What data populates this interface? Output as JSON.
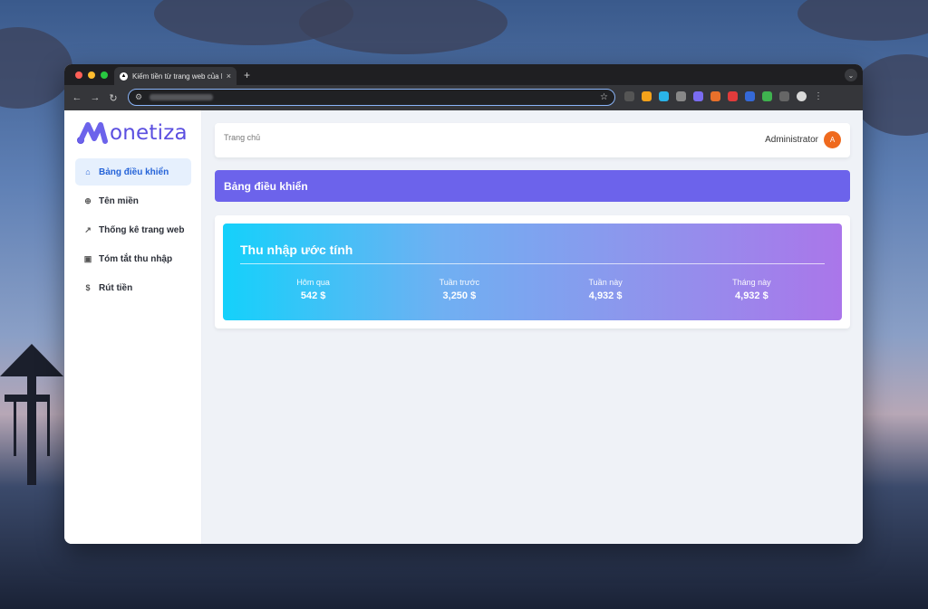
{
  "browser": {
    "tab_title": "Kiếm tiền từ trang web của bạ",
    "tab_close": "×",
    "new_tab": "+",
    "favicon_glyph": "▲"
  },
  "app": {
    "logo_text": "onetiza",
    "sidebar": {
      "items": [
        {
          "label": "Bảng điều khiển",
          "icon": "home-icon",
          "glyph": "⌂",
          "active": true
        },
        {
          "label": "Tên miền",
          "icon": "globe-icon",
          "glyph": "⊕"
        },
        {
          "label": "Thống kê trang web",
          "icon": "trending-up-icon",
          "glyph": "↗"
        },
        {
          "label": "Tóm tắt thu nhập",
          "icon": "wallet-icon",
          "glyph": "▣"
        },
        {
          "label": "Rút tiền",
          "icon": "dollar-circle-icon",
          "glyph": "$"
        }
      ]
    },
    "header": {
      "breadcrumb": "Trang chủ",
      "user_name": "Administrator",
      "avatar_initial": "A"
    },
    "page_title": "Bảng điều khiển",
    "earnings": {
      "title": "Thu nhập ước tính",
      "stats": [
        {
          "label": "Hôm qua",
          "value": "542 $"
        },
        {
          "label": "Tuần trước",
          "value": "3,250 $"
        },
        {
          "label": "Tuần này",
          "value": "4,932 $"
        },
        {
          "label": "Tháng này",
          "value": "4,932 $"
        }
      ]
    }
  },
  "colors": {
    "accent": "#6c63eb",
    "active_menu_bg": "#e6f0fd",
    "active_menu_text": "#2563d8",
    "avatar": "#ef6a1e"
  }
}
